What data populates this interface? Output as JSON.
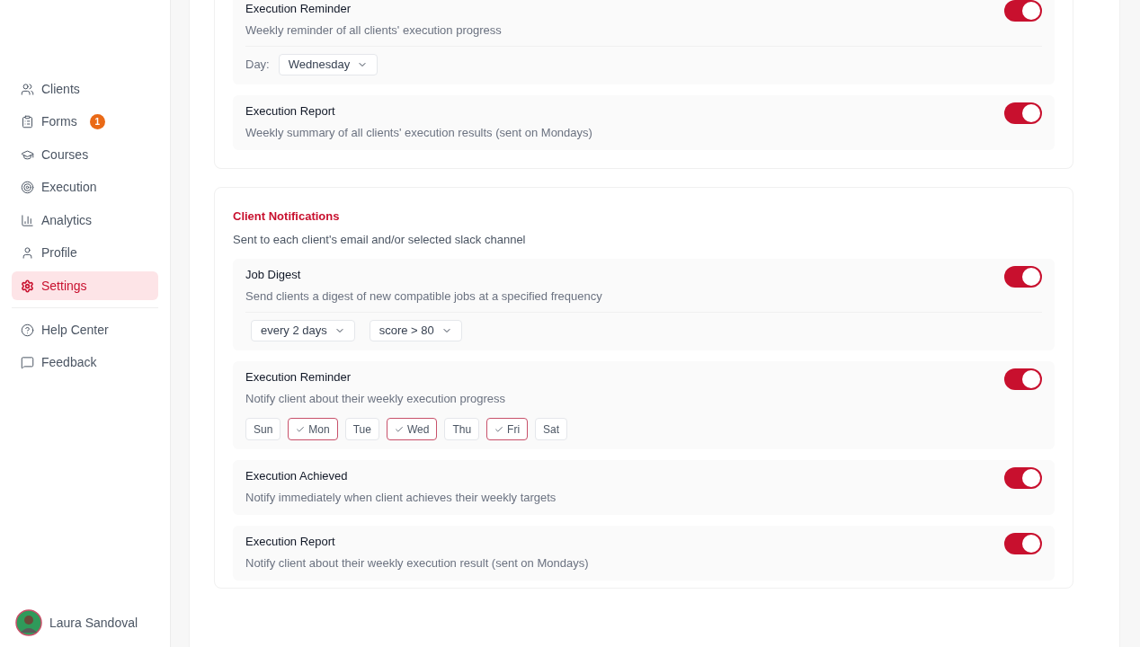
{
  "sidebar": {
    "items": [
      {
        "label": "Clients",
        "selected": false
      },
      {
        "label": "Forms",
        "selected": false,
        "badge": "1"
      },
      {
        "label": "Courses",
        "selected": false
      },
      {
        "label": "Execution",
        "selected": false
      },
      {
        "label": "Analytics",
        "selected": false
      },
      {
        "label": "Profile",
        "selected": false
      },
      {
        "label": "Settings",
        "selected": true
      }
    ],
    "footer_items": [
      {
        "label": "Help Center",
        "selected": false
      },
      {
        "label": "Feedback",
        "selected": false
      }
    ],
    "user": {
      "name": "Laura Sandoval"
    }
  },
  "sections": [
    {
      "rows": [
        {
          "title": "Execution Reminder",
          "description": "Weekly reminder of all clients' execution progress",
          "on": true,
          "extra": {
            "kind": "labeled_select",
            "label": "Day:",
            "value": "Wednesday"
          }
        },
        {
          "title": "Execution Report",
          "description": "Weekly summary of all clients' execution results (sent on Mondays)",
          "on": true
        }
      ]
    },
    {
      "title": "Client Notifications",
      "description": "Sent to each client's email and/or selected slack channel",
      "rows": [
        {
          "title": "Job Digest",
          "description": "Send clients a digest of new compatible jobs at a specified frequency",
          "on": true,
          "extra": {
            "kind": "selects",
            "values": [
              "every 2 days",
              "score > 80"
            ]
          }
        },
        {
          "title": "Execution Reminder",
          "description": "Notify client about their weekly execution progress",
          "on": true,
          "extra": {
            "kind": "days",
            "days": [
              {
                "label": "Sun",
                "selected": false
              },
              {
                "label": "Mon",
                "selected": true
              },
              {
                "label": "Tue",
                "selected": false
              },
              {
                "label": "Wed",
                "selected": true
              },
              {
                "label": "Thu",
                "selected": false
              },
              {
                "label": "Fri",
                "selected": true
              },
              {
                "label": "Sat",
                "selected": false
              }
            ]
          }
        },
        {
          "title": "Execution Achieved",
          "description": "Notify immediately when client achieves their weekly targets",
          "on": true
        },
        {
          "title": "Execution Report",
          "description": "Notify client about their weekly execution result (sent on Mondays)",
          "on": true
        }
      ]
    }
  ]
}
